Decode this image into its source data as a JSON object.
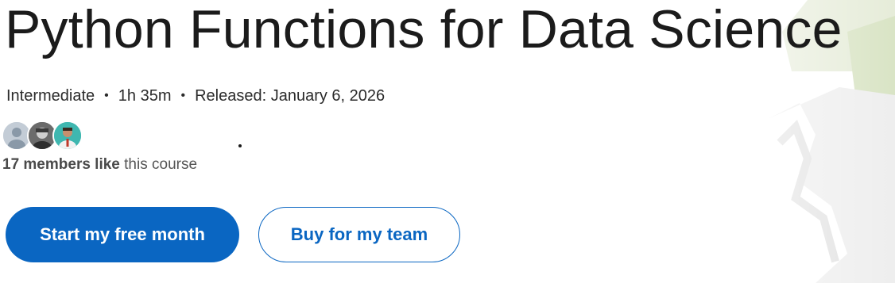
{
  "course": {
    "title": "Python Functions for Data Science",
    "level": "Intermediate",
    "duration": "1h 35m",
    "released": "Released: January 6, 2026"
  },
  "social": {
    "likes_count": "17 members like",
    "likes_suffix": " this course",
    "avatars": [
      "default-avatar",
      "member-avatar-photo",
      "member-avatar-photo"
    ]
  },
  "actions": {
    "primary_label": "Start my free month",
    "secondary_label": "Buy for my team"
  },
  "colors": {
    "primary": "#0a66c2",
    "text": "#1b1b1b",
    "muted": "#555555"
  }
}
